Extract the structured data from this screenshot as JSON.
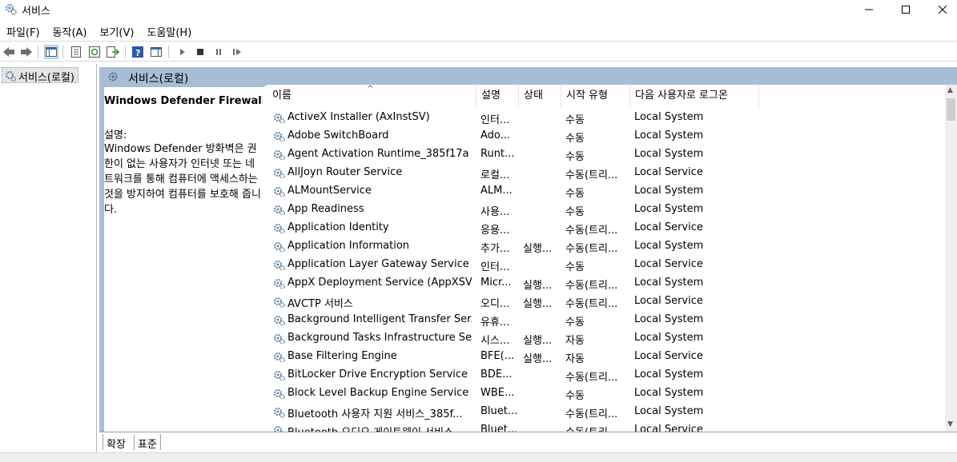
{
  "window": {
    "title": "서비스",
    "icon": "services-gear-icon"
  },
  "menu": [
    "파일(F)",
    "동작(A)",
    "보기(V)",
    "도움말(H)"
  ],
  "tree": {
    "item_label": "서비스(로컬)"
  },
  "header": {
    "label": "서비스(로컬)"
  },
  "description": {
    "service_title": "Windows Defender Firewall",
    "label": "설명:",
    "text": "Windows Defender 방화벽은 권한이 없는 사용자가 인터넷 또는 네트워크를 통해 컴퓨터에 액세스하는 것을 방지하여 컴퓨터를 보호해 줍니다."
  },
  "columns": {
    "name": "이름",
    "desc": "설명",
    "status": "상태",
    "startup": "시작 유형",
    "logon": "다음 사용자로 로그온"
  },
  "rows": [
    {
      "name": "ActiveX Installer (AxInstSV)",
      "desc": "인터...",
      "status": "",
      "startup": "수동",
      "logon": "Local System"
    },
    {
      "name": "Adobe SwitchBoard",
      "desc": "Ado...",
      "status": "",
      "startup": "수동",
      "logon": "Local System"
    },
    {
      "name": "Agent Activation Runtime_385f17a",
      "desc": "Runt...",
      "status": "",
      "startup": "수동",
      "logon": "Local System"
    },
    {
      "name": "AllJoyn Router Service",
      "desc": "로컬...",
      "status": "",
      "startup": "수동(트리...",
      "logon": "Local Service"
    },
    {
      "name": "ALMountService",
      "desc": "ALM...",
      "status": "",
      "startup": "수동",
      "logon": "Local System"
    },
    {
      "name": "App Readiness",
      "desc": "사용...",
      "status": "",
      "startup": "수동",
      "logon": "Local System"
    },
    {
      "name": "Application Identity",
      "desc": "응용...",
      "status": "",
      "startup": "수동(트리...",
      "logon": "Local Service"
    },
    {
      "name": "Application Information",
      "desc": "추가...",
      "status": "실행...",
      "startup": "수동(트리...",
      "logon": "Local System"
    },
    {
      "name": "Application Layer Gateway Service",
      "desc": "인터...",
      "status": "",
      "startup": "수동",
      "logon": "Local Service"
    },
    {
      "name": "AppX Deployment Service (AppXSV...",
      "desc": "Micr...",
      "status": "실행...",
      "startup": "수동(트리...",
      "logon": "Local System"
    },
    {
      "name": "AVCTP 서비스",
      "desc": "오디...",
      "status": "실행...",
      "startup": "수동(트리...",
      "logon": "Local Service"
    },
    {
      "name": "Background Intelligent Transfer Ser...",
      "desc": "유휴...",
      "status": "",
      "startup": "수동",
      "logon": "Local System"
    },
    {
      "name": "Background Tasks Infrastructure Se...",
      "desc": "시스...",
      "status": "실행...",
      "startup": "자동",
      "logon": "Local System"
    },
    {
      "name": "Base Filtering Engine",
      "desc": "BFE(...",
      "status": "실행...",
      "startup": "자동",
      "logon": "Local Service"
    },
    {
      "name": "BitLocker Drive Encryption Service",
      "desc": "BDE...",
      "status": "",
      "startup": "수동(트리...",
      "logon": "Local System"
    },
    {
      "name": "Block Level Backup Engine Service",
      "desc": "WBE...",
      "status": "",
      "startup": "수동",
      "logon": "Local System"
    },
    {
      "name": "Bluetooth 사용자 지원 서비스_385f...",
      "desc": "Bluet...",
      "status": "",
      "startup": "수동(트리...",
      "logon": "Local System"
    },
    {
      "name": "Bluetooth 오디오 게이트웨이 서비스",
      "desc": "Bluet...",
      "status": "",
      "startup": "수동(트리...",
      "logon": "Local Service"
    }
  ],
  "tabs": {
    "extended": "확장",
    "standard": "표준"
  }
}
